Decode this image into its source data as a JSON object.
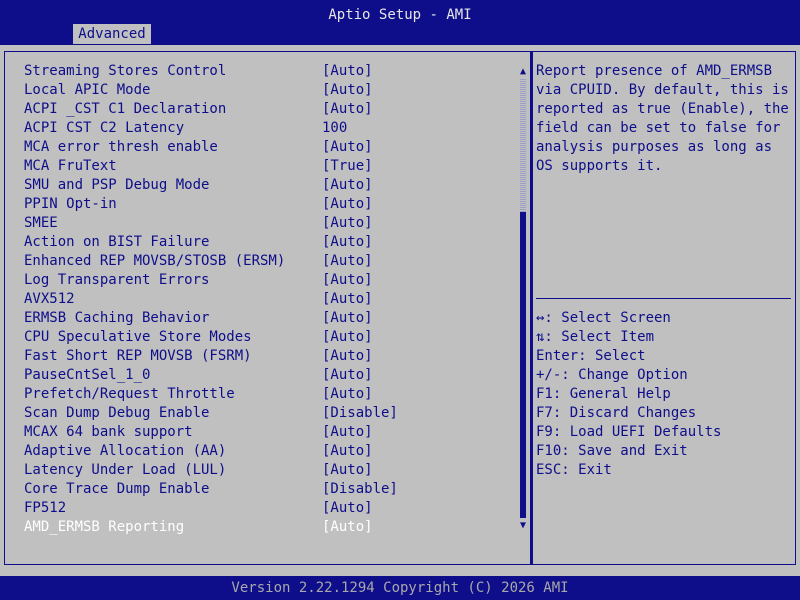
{
  "title": "Aptio Setup - AMI",
  "tab": "Advanced",
  "items": [
    {
      "label": "Streaming Stores Control",
      "value": "[Auto]"
    },
    {
      "label": "Local APIC Mode",
      "value": "[Auto]"
    },
    {
      "label": "ACPI _CST C1 Declaration",
      "value": "[Auto]"
    },
    {
      "label": "ACPI CST C2 Latency",
      "value": "100"
    },
    {
      "label": "MCA error thresh enable",
      "value": "[Auto]"
    },
    {
      "label": "MCA FruText",
      "value": "[True]"
    },
    {
      "label": "SMU and PSP Debug Mode",
      "value": "[Auto]"
    },
    {
      "label": "PPIN Opt-in",
      "value": "[Auto]"
    },
    {
      "label": "SMEE",
      "value": "[Auto]"
    },
    {
      "label": "Action on BIST Failure",
      "value": "[Auto]"
    },
    {
      "label": "Enhanced REP MOVSB/STOSB (ERSM)",
      "value": "[Auto]"
    },
    {
      "label": "Log Transparent Errors",
      "value": "[Auto]"
    },
    {
      "label": "AVX512",
      "value": "[Auto]"
    },
    {
      "label": "ERMSB Caching Behavior",
      "value": "[Auto]"
    },
    {
      "label": "CPU Speculative Store Modes",
      "value": "[Auto]"
    },
    {
      "label": "Fast Short REP MOVSB (FSRM)",
      "value": "[Auto]"
    },
    {
      "label": "PauseCntSel_1_0",
      "value": "[Auto]"
    },
    {
      "label": "Prefetch/Request Throttle",
      "value": "[Auto]"
    },
    {
      "label": "Scan Dump Debug Enable",
      "value": "[Disable]"
    },
    {
      "label": "MCAX 64 bank support",
      "value": "[Auto]"
    },
    {
      "label": "Adaptive Allocation (AA)",
      "value": "[Auto]"
    },
    {
      "label": "Latency Under Load (LUL)",
      "value": "[Auto]"
    },
    {
      "label": "Core Trace Dump Enable",
      "value": "[Disable]"
    },
    {
      "label": "FP512",
      "value": "[Auto]"
    },
    {
      "label": "AMD_ERMSB Reporting",
      "value": "[Auto]"
    }
  ],
  "selected_index": 24,
  "help_text": "Report presence of AMD_ERMSB\nvia CPUID. By default, this is\nreported as true (Enable), the\nfield can be set to false for\nanalysis purposes as long as\nOS supports it.",
  "keys": [
    "↔: Select Screen",
    "⇅: Select Item",
    "Enter: Select",
    "+/-: Change Option",
    "F1: General Help",
    "F7: Discard Changes",
    "F9: Load UEFI Defaults",
    "F10: Save and Exit",
    "ESC: Exit"
  ],
  "scroll_up_icon": "▲",
  "scroll_down_icon": "▼",
  "footer": "Version 2.22.1294 Copyright (C) 2026 AMI",
  "colors": {
    "bar": "#0e0e8a",
    "background": "#c0c0c0",
    "text": "#0e0e8a",
    "selected": "#ffffff",
    "footer_text": "#a8a8a8"
  }
}
